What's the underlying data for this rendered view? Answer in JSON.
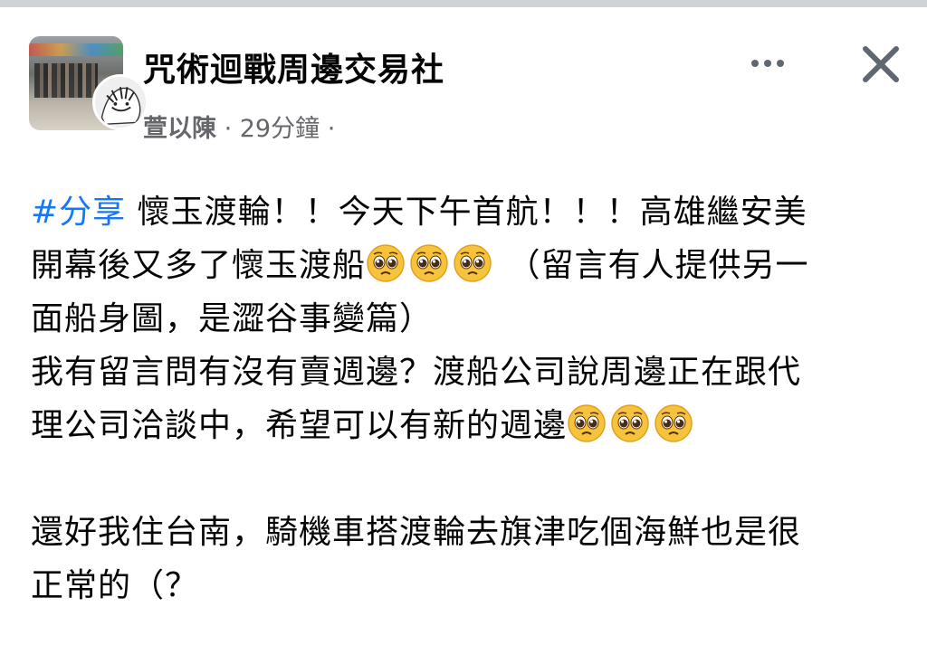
{
  "group": {
    "name": "咒術迴戰周邊交易社"
  },
  "meta": {
    "author": "萱以陳",
    "separator": " · ",
    "time": "29分鐘",
    "trailing": " ·"
  },
  "icons": {
    "more": "more-horizontal-icon",
    "close": "close-icon",
    "emoji": "pleading-face-emoji"
  },
  "post": {
    "hashtag": "#分享",
    "line1_rest": " 懷玉渡輪！！今天下午首航！！！高雄繼安美",
    "line2": "開幕後又多了懷玉渡船",
    "line2_rest": " （留言有人提供另一",
    "line3": "面船身圖，是澀谷事變篇）",
    "line4": "我有留言問有沒有賣週邊？渡船公司說周邊正在跟代",
    "line5": "理公司洽談中，希望可以有新的週邊",
    "line6": "還好我住台南，騎機車搭渡輪去旗津吃個海鮮也是很",
    "line7": "正常的（？"
  },
  "colors": {
    "hashtag": "#1877f2",
    "meta": "#65676b",
    "text": "#050505"
  }
}
